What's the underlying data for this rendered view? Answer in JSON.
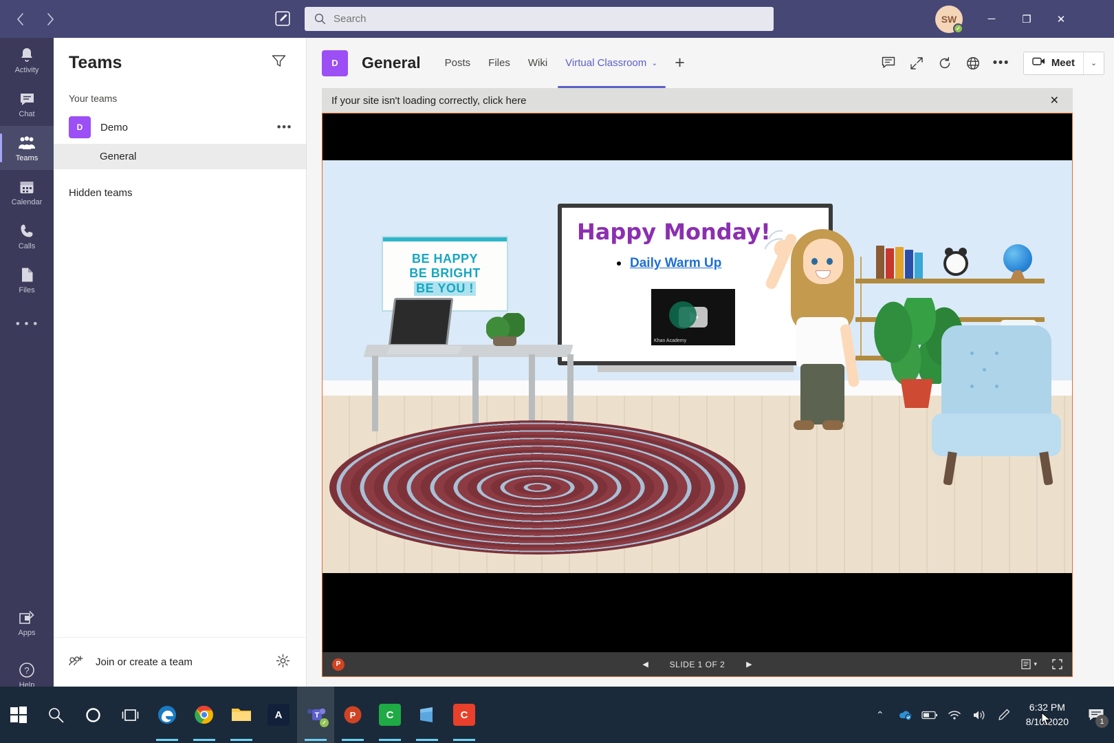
{
  "titlebar": {
    "back_icon": "back-arrow-icon",
    "forward_icon": "forward-arrow-icon",
    "compose_icon": "compose-icon",
    "search": {
      "placeholder": "Search",
      "value": "",
      "icon": "search-icon"
    },
    "avatar": {
      "initials": "SW",
      "status": "available"
    },
    "minimize": "─",
    "maximize": "❐",
    "close": "✕"
  },
  "rail": {
    "items": [
      {
        "label": "Activity",
        "icon": "bell-icon",
        "active": false
      },
      {
        "label": "Chat",
        "icon": "chat-icon",
        "active": false
      },
      {
        "label": "Teams",
        "icon": "teams-icon",
        "active": true
      },
      {
        "label": "Calendar",
        "icon": "calendar-icon",
        "active": false
      },
      {
        "label": "Calls",
        "icon": "phone-icon",
        "active": false
      },
      {
        "label": "Files",
        "icon": "file-icon",
        "active": false
      }
    ],
    "more": "• • •",
    "apps": {
      "label": "Apps",
      "icon": "apps-icon"
    },
    "help": {
      "label": "Help",
      "icon": "help-icon"
    }
  },
  "teams_panel": {
    "title": "Teams",
    "filter_icon": "filter-icon",
    "your_teams_label": "Your teams",
    "team": {
      "name": "Demo",
      "initial": "D",
      "more": "•••"
    },
    "channel": {
      "name": "General"
    },
    "hidden_teams_label": "Hidden teams",
    "join_create": {
      "label": "Join or create a team",
      "icon": "add-people-icon"
    },
    "settings_icon": "gear-icon"
  },
  "channel_header": {
    "team_initial": "D",
    "channel_name": "General",
    "tabs": [
      {
        "label": "Posts",
        "active": false
      },
      {
        "label": "Files",
        "active": false
      },
      {
        "label": "Wiki",
        "active": false
      },
      {
        "label": "Virtual Classroom",
        "active": true,
        "chevron": "⌄"
      }
    ],
    "add_tab": "+",
    "actions": [
      {
        "icon": "conversation-icon"
      },
      {
        "icon": "expand-icon"
      },
      {
        "icon": "refresh-icon"
      },
      {
        "icon": "globe-icon"
      },
      {
        "icon": "more-options-icon"
      }
    ],
    "meet": {
      "label": "Meet",
      "icon": "camera-icon",
      "chevron": "⌄"
    }
  },
  "notice": {
    "text": "If your site isn't loading correctly, click here",
    "close": "✕"
  },
  "slide": {
    "poster": {
      "line1": "BE HAPPY",
      "line2": "BE BRIGHT",
      "line3": "BE YOU !"
    },
    "board": {
      "title": "Happy Monday!",
      "bullet_link": "Daily Warm Up",
      "video_brand": "Khan Academy"
    },
    "footer": {
      "app_initial": "P",
      "prev_icon": "◀",
      "next_icon": "▶",
      "counter": "SLIDE 1 OF 2",
      "notes_icon": "notes-icon",
      "notes_chevron": "▾",
      "fullscreen_icon": "fullscreen-icon"
    }
  },
  "taskbar": {
    "start": {
      "icon": "windows-start-icon"
    },
    "search": {
      "icon": "taskbar-search-icon"
    },
    "cortana": {
      "icon": "cortana-icon"
    },
    "taskview": {
      "icon": "task-view-icon"
    },
    "apps": [
      {
        "name": "edge",
        "label": "e",
        "color": "#1a7bc4",
        "running": true,
        "active": false
      },
      {
        "name": "chrome",
        "label": "",
        "color": "#ffffff",
        "running": true,
        "active": false
      },
      {
        "name": "file-explorer",
        "label": "",
        "color": "#ffc646",
        "running": true,
        "active": false
      },
      {
        "name": "anaconda",
        "label": "A",
        "color": "#12203a",
        "running": false,
        "active": false
      },
      {
        "name": "microsoft-teams",
        "label": "T",
        "color": "#5b5fc7",
        "running": true,
        "active": true
      },
      {
        "name": "powerpoint",
        "label": "P",
        "color": "#d04423",
        "running": true,
        "active": false
      },
      {
        "name": "green-app",
        "label": "C",
        "color": "#1faa45",
        "running": true,
        "active": false
      },
      {
        "name": "microsoft-store",
        "label": "",
        "color": "#5aa7e0",
        "running": true,
        "active": false
      },
      {
        "name": "red-app",
        "label": "C",
        "color": "#e8402a",
        "running": true,
        "active": false
      }
    ],
    "tray": {
      "chevron": "⌃",
      "onedrive": "onedrive-icon",
      "battery": "battery-icon",
      "wifi": "wifi-icon",
      "volume": "volume-icon",
      "pen": "pen-icon",
      "time": "6:32 PM",
      "date": "8/10/2020",
      "notifications": {
        "icon": "notification-icon",
        "count": "1"
      }
    }
  }
}
